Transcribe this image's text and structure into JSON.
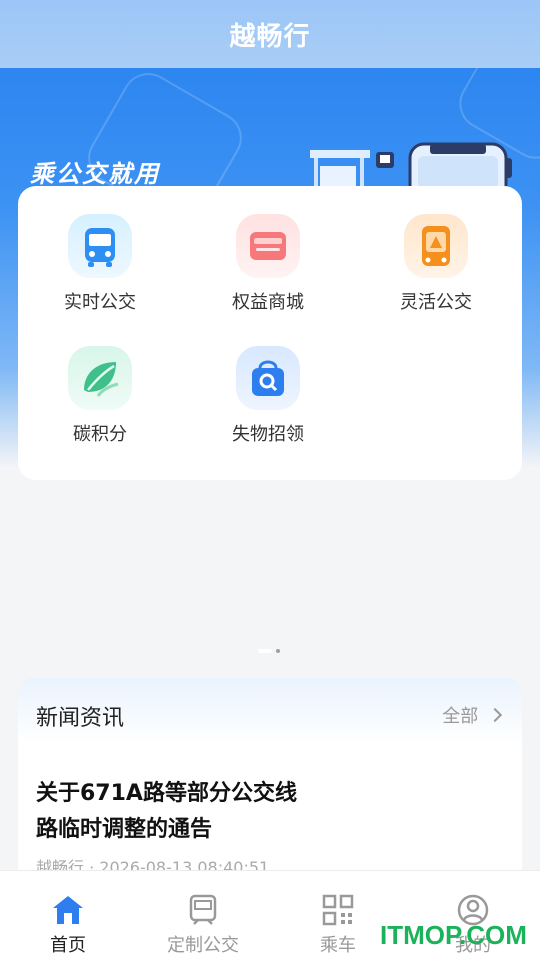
{
  "header": {
    "title": "越畅行"
  },
  "banner": {
    "slogan": "乘公交就用"
  },
  "services": [
    {
      "label": "实时公交",
      "icon": "bus-icon"
    },
    {
      "label": "权益商城",
      "icon": "wallet-icon"
    },
    {
      "label": "灵活公交",
      "icon": "flexible-bus-icon"
    },
    {
      "label": "碳积分",
      "icon": "leaf-icon"
    },
    {
      "label": "失物招领",
      "icon": "lost-found-bag-icon"
    }
  ],
  "news": {
    "title": "新闻资讯",
    "all_label": "全部",
    "headline_line1": "关于671A路等部分公交线",
    "headline_line2": "路临时调整的通告",
    "meta": "越畅行 · 2026-08-13 08:40:51"
  },
  "tabbar": [
    {
      "label": "首页",
      "icon": "home-icon",
      "active": true
    },
    {
      "label": "定制公交",
      "icon": "custom-bus-icon",
      "active": false
    },
    {
      "label": "乘车",
      "icon": "qr-code-icon",
      "active": false
    },
    {
      "label": "我的",
      "icon": "user-icon",
      "active": false
    }
  ],
  "watermark": "ITMOP.COM",
  "colors": {
    "primary": "#2d86f0",
    "header": "#9cc6f7",
    "active_tab": "#2f7ef0",
    "watermark": "#1bb35a"
  }
}
